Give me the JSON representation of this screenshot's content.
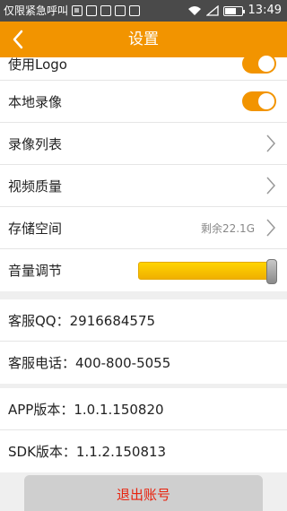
{
  "status_bar": {
    "carrier": "仅限紧急呼叫",
    "time": "13:49",
    "battery_level": 0.6
  },
  "header": {
    "title": "设置",
    "back_icon": "chevron-left-icon"
  },
  "settings": {
    "use_logo": {
      "label": "使用Logo",
      "enabled": true
    },
    "local_record": {
      "label": "本地录像",
      "enabled": true
    },
    "record_list": {
      "label": "录像列表"
    },
    "video_quality": {
      "label": "视频质量"
    },
    "storage": {
      "label": "存储空间",
      "value": "剩余22.1G"
    },
    "volume": {
      "label": "音量调节",
      "level": 1.0
    }
  },
  "service": {
    "qq": "客服QQ：2916684575",
    "phone": "客服电话：400-800-5055"
  },
  "versions": {
    "app": "APP版本：1.0.1.150820",
    "sdk": "SDK版本：1.1.2.150813"
  },
  "logout_label": "退出账号",
  "colors": {
    "accent": "#f29400",
    "logout_text": "#e8230e"
  }
}
